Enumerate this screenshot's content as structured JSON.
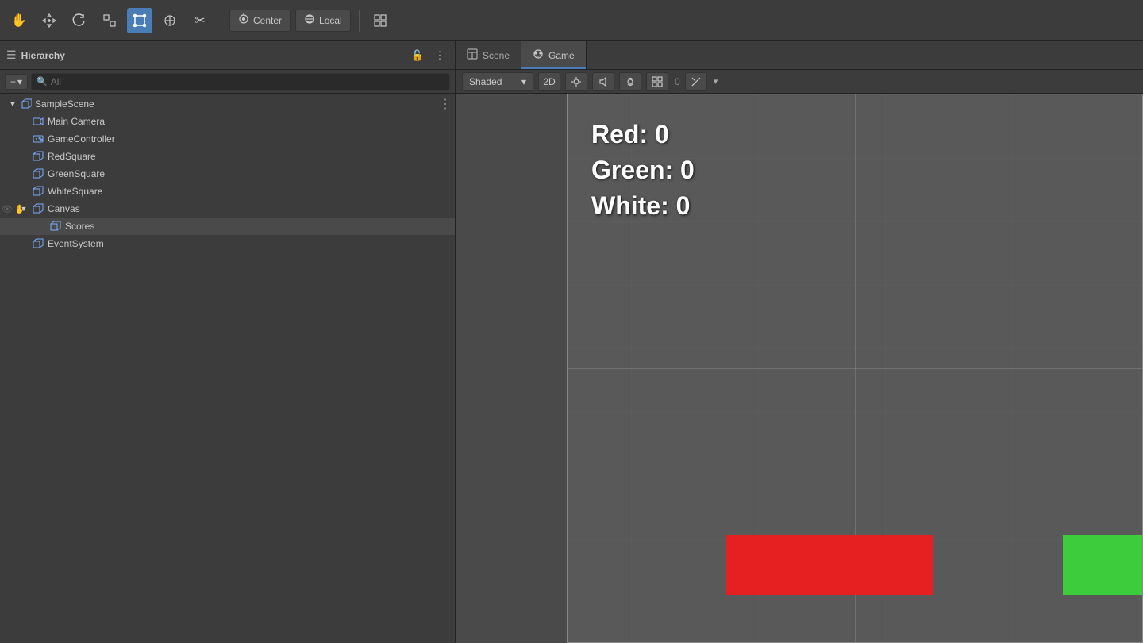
{
  "toolbar": {
    "tools": [
      {
        "id": "hand",
        "icon": "✋",
        "label": "Hand Tool",
        "active": false
      },
      {
        "id": "move",
        "icon": "✛",
        "label": "Move Tool",
        "active": false
      },
      {
        "id": "rotate",
        "icon": "↺",
        "label": "Rotate Tool",
        "active": false
      },
      {
        "id": "scale",
        "icon": "⊡",
        "label": "Scale Tool",
        "active": false
      },
      {
        "id": "rect",
        "icon": "▭",
        "label": "Rect Tool",
        "active": true
      },
      {
        "id": "transform",
        "icon": "⊕",
        "label": "Transform Tool",
        "active": false
      },
      {
        "id": "custom",
        "icon": "✂",
        "label": "Custom Tool",
        "active": false
      }
    ],
    "pivot_label": "Center",
    "space_label": "Local",
    "snap_icon": "⊞"
  },
  "hierarchy": {
    "title": "Hierarchy",
    "search_placeholder": "All",
    "items": [
      {
        "id": "sample-scene",
        "label": "SampleScene",
        "depth": 0,
        "has_children": true,
        "expanded": true,
        "has_options": true
      },
      {
        "id": "main-camera",
        "label": "Main Camera",
        "depth": 1,
        "has_children": false
      },
      {
        "id": "game-controller",
        "label": "GameController",
        "depth": 1,
        "has_children": false
      },
      {
        "id": "red-square",
        "label": "RedSquare",
        "depth": 1,
        "has_children": false
      },
      {
        "id": "green-square",
        "label": "GreenSquare",
        "depth": 1,
        "has_children": false
      },
      {
        "id": "white-square",
        "label": "WhiteSquare",
        "depth": 1,
        "has_children": false
      },
      {
        "id": "canvas",
        "label": "Canvas",
        "depth": 1,
        "has_children": true,
        "expanded": true
      },
      {
        "id": "scores",
        "label": "Scores",
        "depth": 2,
        "has_children": false,
        "hovered": true
      },
      {
        "id": "event-system",
        "label": "EventSystem",
        "depth": 1,
        "has_children": false
      }
    ]
  },
  "tabs": {
    "scene": {
      "label": "Scene",
      "active": false
    },
    "game": {
      "label": "Game",
      "active": true
    }
  },
  "scene_toolbar": {
    "shaded_label": "Shaded",
    "2d_label": "2D"
  },
  "game_view": {
    "scores": {
      "red_label": "Red: 0",
      "green_label": "Green: 0",
      "white_label": "White: 0"
    }
  }
}
